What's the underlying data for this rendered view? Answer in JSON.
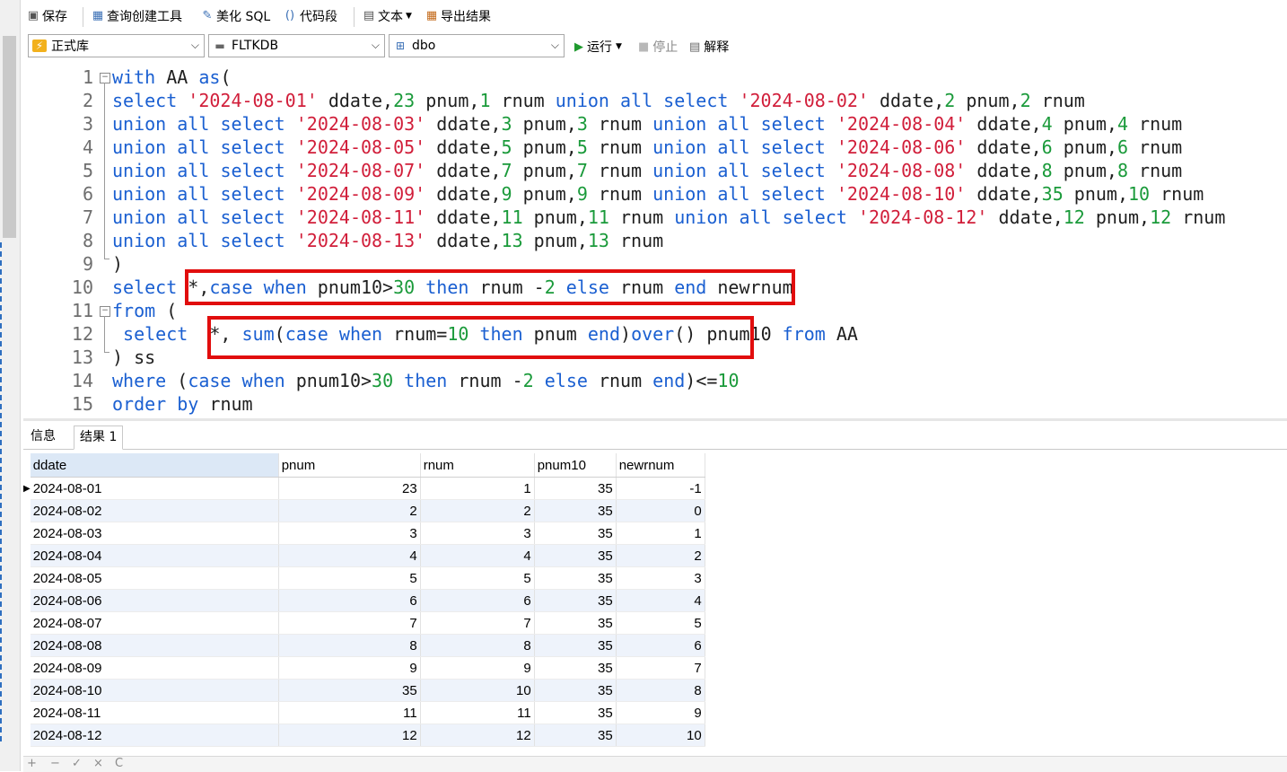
{
  "toolbar": {
    "save": "保存",
    "query_builder": "查询创建工具",
    "beautify_sql": "美化 SQL",
    "code_snippet": "代码段",
    "text": "文本",
    "export_results": "导出结果",
    "connection": "正式库",
    "database": "FLTKDB",
    "schema": "dbo",
    "run": "运行",
    "stop": "停止",
    "explain": "解释"
  },
  "editor": {
    "line_numbers": [
      "1",
      "2",
      "3",
      "4",
      "5",
      "6",
      "7",
      "8",
      "9",
      "10",
      "11",
      "12",
      "13",
      "14",
      "15"
    ],
    "lines": [
      "with AA as(",
      "select '2024-08-01' ddate,23 pnum,1 rnum union all select '2024-08-02' ddate,2 pnum,2 rnum",
      "union all select '2024-08-03' ddate,3 pnum,3 rnum union all select '2024-08-04' ddate,4 pnum,4 rnum",
      "union all select '2024-08-05' ddate,5 pnum,5 rnum union all select '2024-08-06' ddate,6 pnum,6 rnum",
      "union all select '2024-08-07' ddate,7 pnum,7 rnum union all select '2024-08-08' ddate,8 pnum,8 rnum",
      "union all select '2024-08-09' ddate,9 pnum,9 rnum union all select '2024-08-10' ddate,35 pnum,10 rnum",
      "union all select '2024-08-11' ddate,11 pnum,11 rnum union all select '2024-08-12' ddate,12 pnum,12 rnum",
      "union all select '2024-08-13' ddate,13 pnum,13 rnum",
      ")",
      "select *,case when pnum10>30 then rnum -2 else rnum end newrnum",
      "from (",
      " select  *, sum(case when rnum=10 then pnum end)over() pnum10 from AA",
      ") ss",
      "where (case when pnum10>30 then rnum -2 else rnum end)<=10",
      "order by rnum"
    ]
  },
  "tabs": [
    "信息",
    "结果 1"
  ],
  "grid": {
    "columns": [
      "ddate",
      "pnum",
      "rnum",
      "pnum10",
      "newrnum"
    ],
    "rows": [
      [
        "2024-08-01",
        "23",
        "1",
        "35",
        "-1"
      ],
      [
        "2024-08-02",
        "2",
        "2",
        "35",
        "0"
      ],
      [
        "2024-08-03",
        "3",
        "3",
        "35",
        "1"
      ],
      [
        "2024-08-04",
        "4",
        "4",
        "35",
        "2"
      ],
      [
        "2024-08-05",
        "5",
        "5",
        "35",
        "3"
      ],
      [
        "2024-08-06",
        "6",
        "6",
        "35",
        "4"
      ],
      [
        "2024-08-07",
        "7",
        "7",
        "35",
        "5"
      ],
      [
        "2024-08-08",
        "8",
        "8",
        "35",
        "6"
      ],
      [
        "2024-08-09",
        "9",
        "9",
        "35",
        "7"
      ],
      [
        "2024-08-10",
        "35",
        "10",
        "35",
        "8"
      ],
      [
        "2024-08-11",
        "11",
        "11",
        "35",
        "9"
      ],
      [
        "2024-08-12",
        "12",
        "12",
        "35",
        "10"
      ]
    ]
  },
  "bottom_bar": [
    "+",
    "−",
    "✓",
    "×",
    "C"
  ],
  "colors": {
    "keyword": "#1a5fd1",
    "string": "#d11e3a",
    "number": "#1a9a3a",
    "highlight_box": "#e10d0d"
  }
}
